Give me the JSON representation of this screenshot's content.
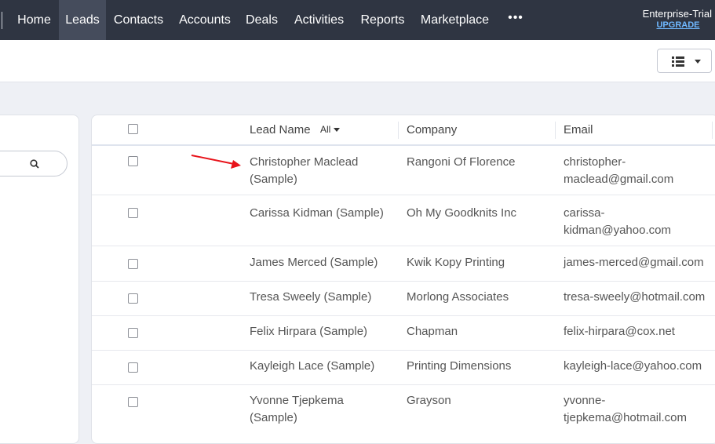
{
  "nav": {
    "items": [
      "Home",
      "Leads",
      "Contacts",
      "Accounts",
      "Deals",
      "Activities",
      "Reports",
      "Marketplace"
    ],
    "active": "Leads",
    "more": "•••"
  },
  "plan": {
    "name": "Enterprise-Trial",
    "upgrade": "UPGRADE"
  },
  "toolbar": {
    "view_icon": "list-view-icon"
  },
  "search": {
    "icon": "search-icon",
    "placeholder": ""
  },
  "table": {
    "columns": {
      "lead_name": "Lead Name",
      "filter": "All",
      "company": "Company",
      "email": "Email"
    },
    "rows": [
      {
        "name": "Christopher Maclead (Sample)",
        "company": "Rangoni Of Florence",
        "email": "christopher-maclead@gmail.com"
      },
      {
        "name": "Carissa Kidman (Sample)",
        "company": "Oh My Goodknits Inc",
        "email": "carissa-kidman@yahoo.com"
      },
      {
        "name": "James Merced (Sample)",
        "company": "Kwik Kopy Printing",
        "email": "james-merced@gmail.com"
      },
      {
        "name": "Tresa Sweely (Sample)",
        "company": "Morlong Associates",
        "email": "tresa-sweely@hotmail.com"
      },
      {
        "name": "Felix Hirpara (Sample)",
        "company": "Chapman",
        "email": "felix-hirpara@cox.net"
      },
      {
        "name": "Kayleigh Lace (Sample)",
        "company": "Printing Dimensions",
        "email": "kayleigh-lace@yahoo.com"
      },
      {
        "name": "Yvonne Tjepkema (Sample)",
        "company": "Grayson",
        "email": "yvonne-tjepkema@hotmail.com"
      }
    ]
  },
  "colors": {
    "nav_bg": "#2f3542",
    "nav_active": "#454c5c",
    "upgrade": "#6fb8ff",
    "annotation": "#e8141b"
  }
}
